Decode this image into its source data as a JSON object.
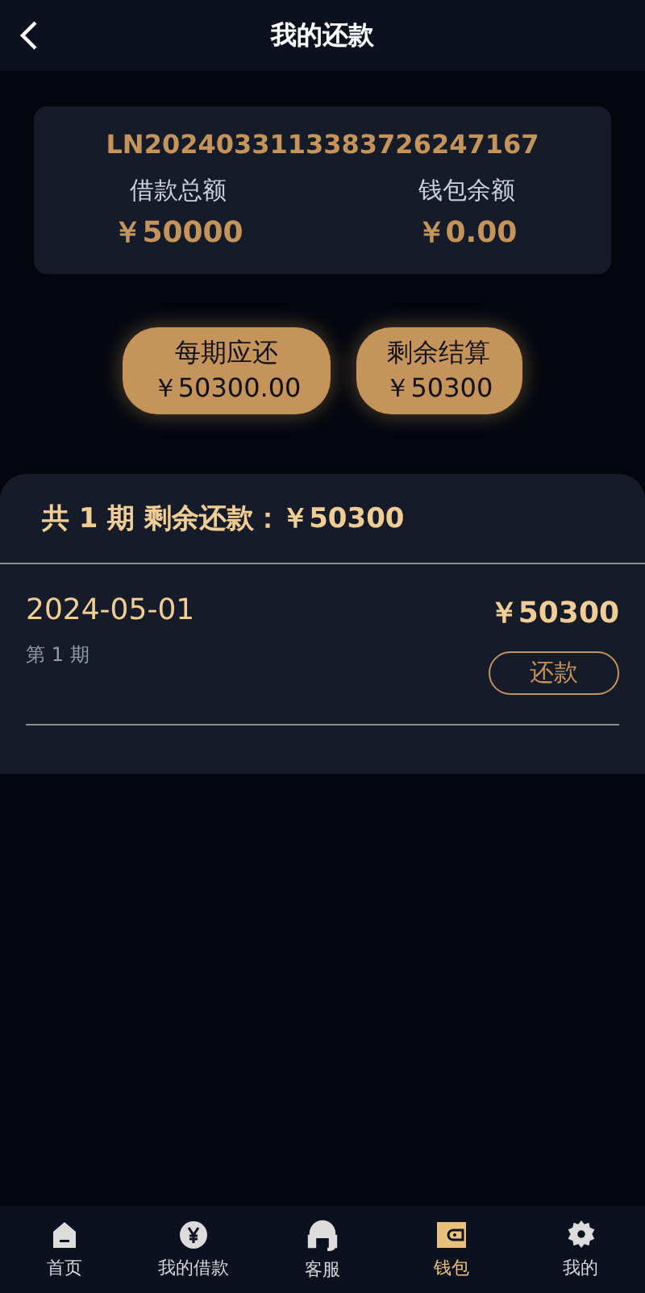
{
  "header": {
    "title": "我的还款"
  },
  "loan": {
    "number": "LN2024033113383726247167",
    "stats": [
      {
        "label": "借款总额",
        "value": "￥50000"
      },
      {
        "label": "钱包余额",
        "value": "￥0.00"
      }
    ]
  },
  "actions": [
    {
      "label": "每期应还",
      "value": "￥50300.00"
    },
    {
      "label": "剩余结算",
      "value": "￥50300"
    }
  ],
  "summary": "共 1 期 剩余还款：￥50300",
  "installments": [
    {
      "date": "2024-05-01",
      "amount": "￥50300",
      "period": "第 1 期",
      "button": "还款"
    }
  ],
  "tabs": [
    {
      "label": "首页",
      "kind": "home",
      "selected": false
    },
    {
      "label": "我的借款",
      "kind": "yen",
      "selected": false
    },
    {
      "label": "客服",
      "kind": "headset",
      "selected": false
    },
    {
      "label": "钱包",
      "kind": "wallet",
      "selected": true
    },
    {
      "label": "我的",
      "kind": "gear",
      "selected": false
    }
  ]
}
